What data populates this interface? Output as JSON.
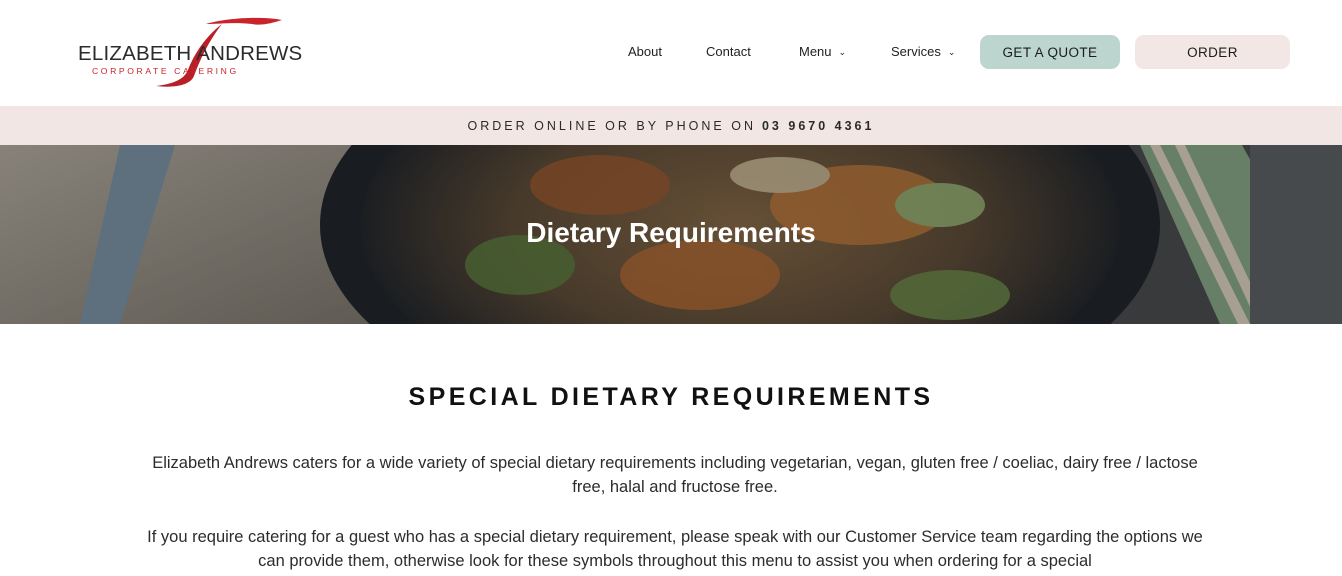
{
  "brand": {
    "name": "ELIZABETH ANDREWS",
    "tagline": "CORPORATE CATERING",
    "accent_color": "#c8242b"
  },
  "nav": {
    "items": [
      {
        "label": "About"
      },
      {
        "label": "Contact"
      },
      {
        "label": "Menu",
        "icon": "chevron-down-icon"
      },
      {
        "label": "Services",
        "icon": "chevron-down-icon"
      }
    ],
    "quote_button": {
      "label": "GET A QUOTE",
      "color": "#bcd6cf"
    },
    "order_button": {
      "label": "ORDER",
      "color": "#f3e7e5"
    }
  },
  "phone_bar": {
    "text": "ORDER ONLINE OR BY PHONE ON",
    "number": "03 9670 4361"
  },
  "hero": {
    "title": "Dietary Requirements"
  },
  "content": {
    "heading": "SPECIAL DIETARY REQUIREMENTS",
    "paragraph1": "Elizabeth Andrews caters for a wide variety of special dietary requirements including vegetarian, vegan, gluten free / coeliac, dairy free / lactose free, halal and fructose free.",
    "paragraph2": "If you require catering for a guest who has a special dietary requirement, please speak with our Customer Service team regarding the options we can provide them, otherwise look for these symbols throughout this menu to assist you when ordering for a special"
  }
}
